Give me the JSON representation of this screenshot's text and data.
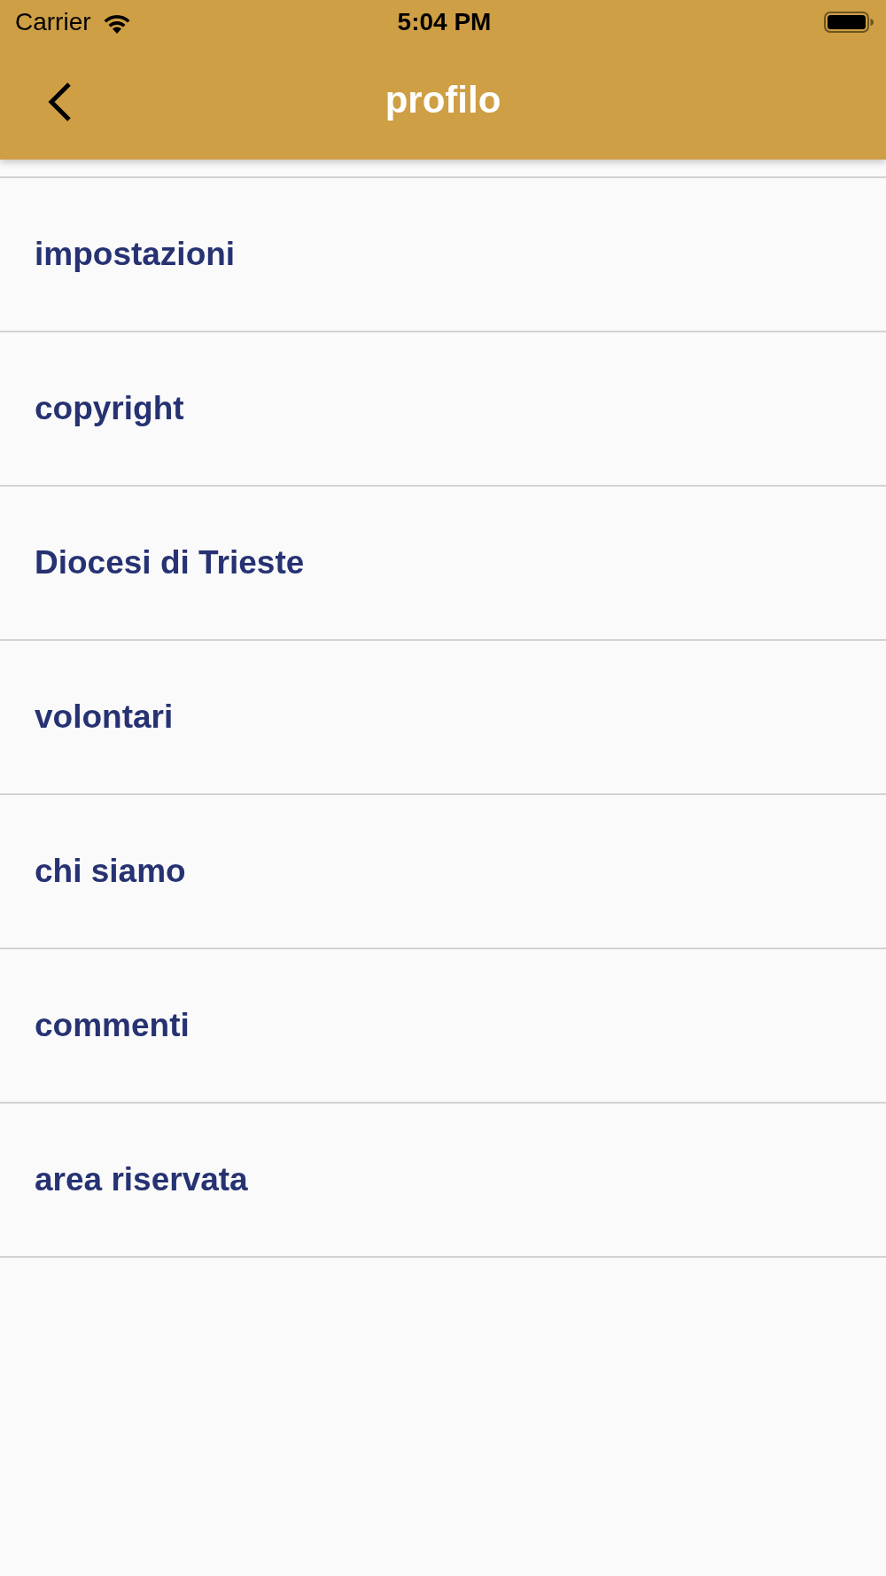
{
  "status_bar": {
    "carrier": "Carrier",
    "time": "5:04 PM"
  },
  "nav_bar": {
    "title": "profilo"
  },
  "menu": {
    "items": [
      {
        "label": "impostazioni"
      },
      {
        "label": "copyright"
      },
      {
        "label": "Diocesi di Trieste"
      },
      {
        "label": "volontari"
      },
      {
        "label": "chi siamo"
      },
      {
        "label": "commenti"
      },
      {
        "label": "area riservata"
      }
    ]
  }
}
